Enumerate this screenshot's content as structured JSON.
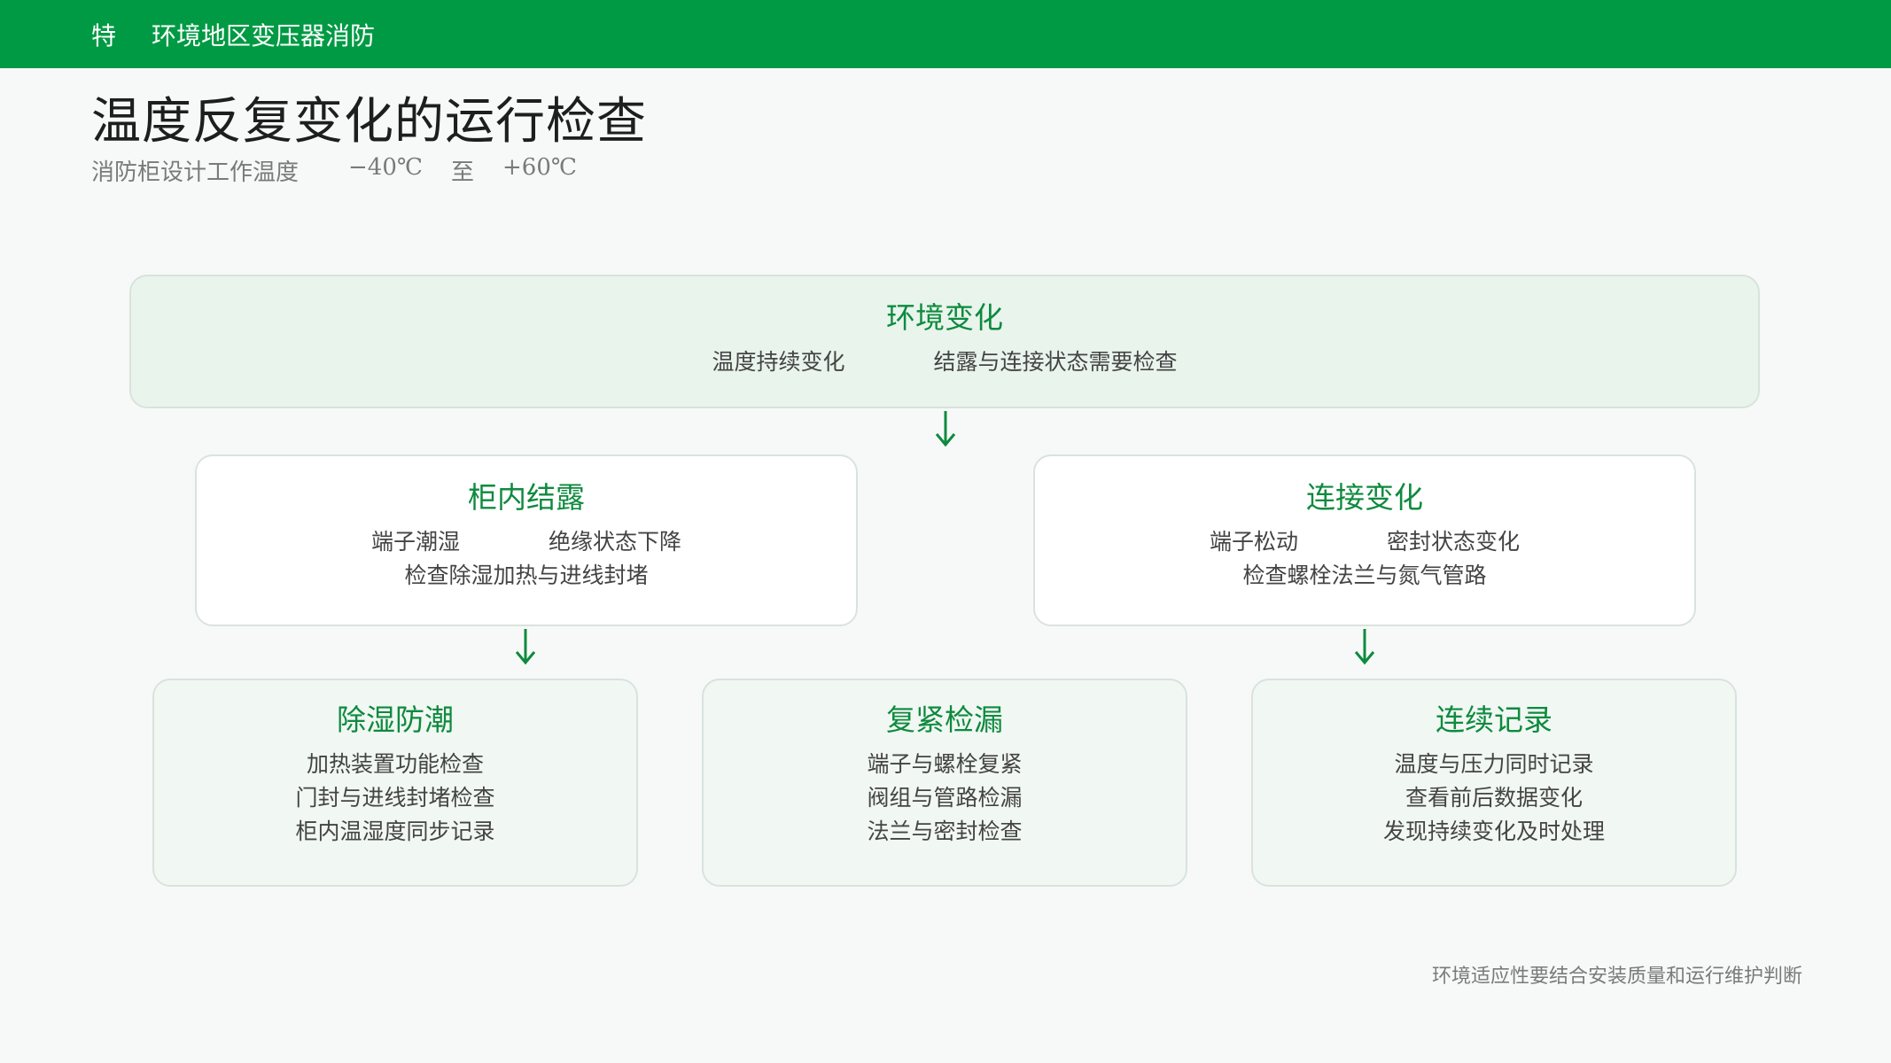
{
  "header": {
    "mark": "特",
    "section": "环境地区变压器消防"
  },
  "title": "温度反复变化的运行检查",
  "subtitle": {
    "label": "消防柜设计工作温度",
    "min": "−40℃",
    "connector": "至",
    "max": "+60℃"
  },
  "colors": {
    "brand": "#009a44",
    "accent_text": "#0e8a3e",
    "top_box_bg": "#e8f4ec",
    "card_bg": "#f1f7f3",
    "arrow": "#0e8a3e"
  },
  "env": {
    "title": "环境变化",
    "left": "温度持续变化",
    "right": "结露与连接状态需要检查"
  },
  "condensation": {
    "title": "柜内结露",
    "left": "端子潮湿",
    "right": "绝缘状态下降",
    "note": "检查除湿加热与进线封堵"
  },
  "connection": {
    "title": "连接变化",
    "left": "端子松动",
    "right": "密封状态变化",
    "note": "检查螺栓法兰与氮气管路"
  },
  "dehumidify": {
    "title": "除湿防潮",
    "items": [
      "加热装置功能检查",
      "门封与进线封堵检查",
      "柜内温湿度同步记录"
    ]
  },
  "retighten": {
    "title": "复紧检漏",
    "items": [
      "端子与螺栓复紧",
      "阀组与管路检漏",
      "法兰与密封检查"
    ]
  },
  "record": {
    "title": "连续记录",
    "items": [
      "温度与压力同时记录",
      "查看前后数据变化",
      "发现持续变化及时处理"
    ]
  },
  "footer": "环境适应性要结合安装质量和运行维护判断",
  "icons": [
    "arrow-down-icon"
  ]
}
